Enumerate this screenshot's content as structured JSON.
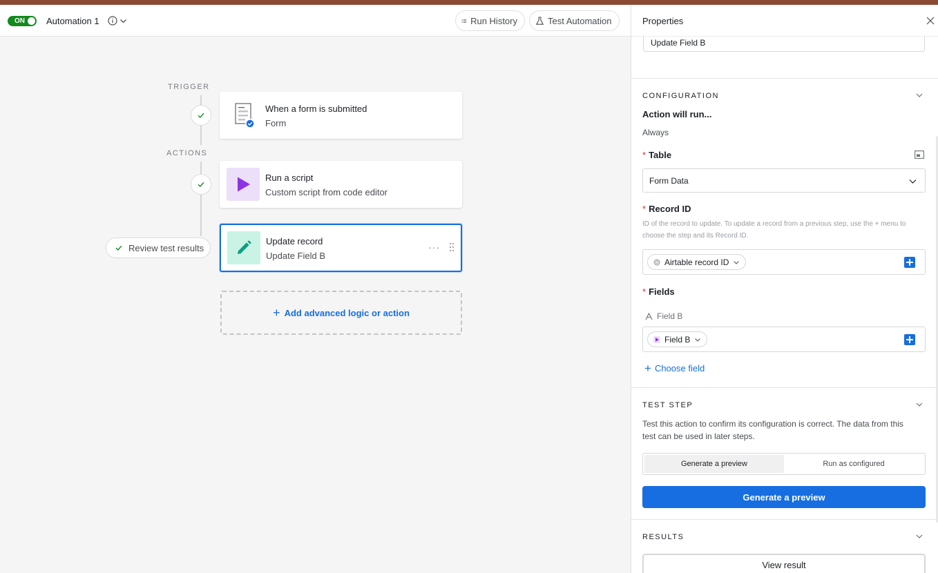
{
  "header": {
    "toggle_label": "ON",
    "automation_name": "Automation 1",
    "run_history_label": "Run History",
    "test_automation_label": "Test Automation"
  },
  "flow": {
    "trigger_label": "TRIGGER",
    "actions_label": "ACTIONS",
    "trigger_card": {
      "title": "When a form is submitted",
      "subtitle": "Form"
    },
    "script_card": {
      "title": "Run a script",
      "subtitle": "Custom script from code editor"
    },
    "update_card": {
      "title": "Update record",
      "subtitle": "Update Field B",
      "more": "···"
    },
    "review_label": "Review test results",
    "add_label": "Add advanced logic or action"
  },
  "panel": {
    "title": "Properties",
    "step_name_value": "Update Field B",
    "configuration": {
      "heading": "CONFIGURATION",
      "action_runs_label": "Action will run...",
      "action_runs_value": "Always",
      "table_label": "Table",
      "table_value": "Form Data",
      "record_id_label": "Record ID",
      "record_id_help": "ID of the record to update. To update a record from a previous step, use the + menu to choose the step and its Record ID.",
      "record_id_token": "Airtable record ID",
      "fields_label": "Fields",
      "field_name": "Field B",
      "field_token": "Field B",
      "choose_field_label": "Choose field"
    },
    "test_step": {
      "heading": "TEST STEP",
      "description": "Test this action to confirm its configuration is correct. The data from this test can be used in later steps.",
      "options": [
        "Generate a preview",
        "Run as configured"
      ],
      "primary_button": "Generate a preview"
    },
    "results": {
      "heading": "RESULTS",
      "view_button": "View result"
    }
  },
  "colors": {
    "accent": "#166ee1",
    "toggle_on": "#138a1e",
    "script_icon_bg": "#ecdffa",
    "script_icon": "#8d33e4",
    "update_icon_bg": "#c9f3e4",
    "update_icon": "#0e9e83",
    "top_strip": "#8b4a34"
  }
}
